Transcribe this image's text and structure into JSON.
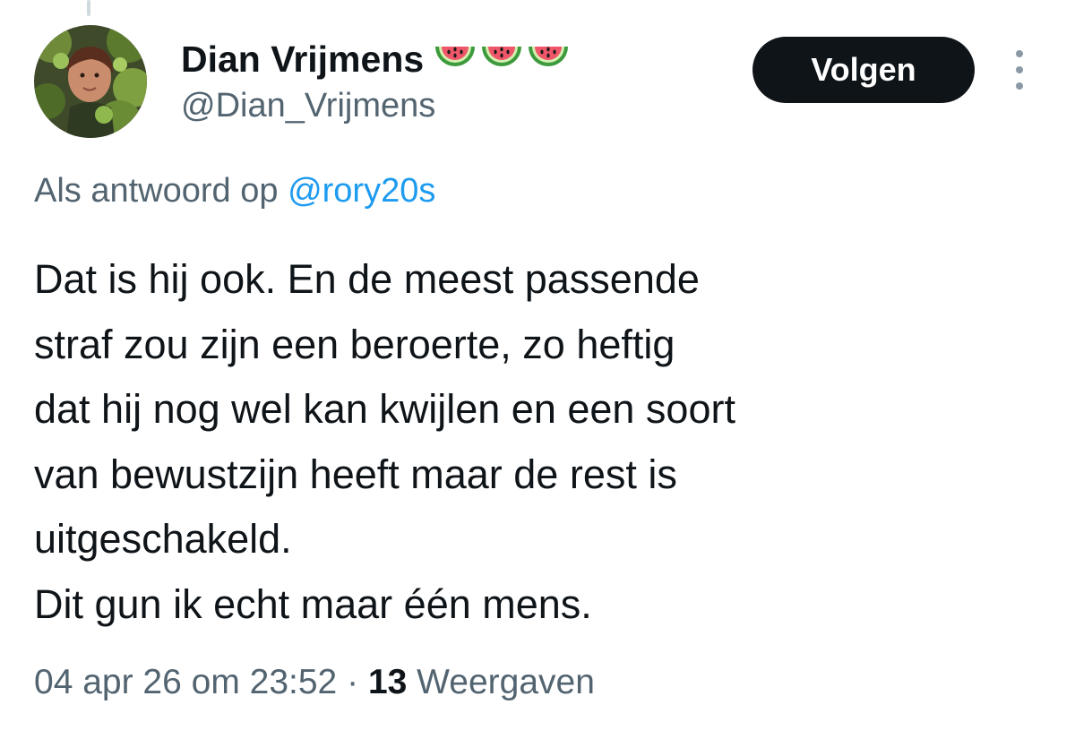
{
  "author": {
    "name": "Dian Vrijmens",
    "handle": "@Dian_Vrijmens",
    "badges": [
      "watermelon-emoji",
      "watermelon-emoji",
      "watermelon-emoji"
    ]
  },
  "follow_button": {
    "label": "Volgen"
  },
  "more_menu": {
    "icon": "more-vertical-icon"
  },
  "reply_context": {
    "prefix": "Als antwoord op",
    "mention": "@rory20s"
  },
  "tweet": {
    "lines": [
      "Dat is hij ook. En de meest passende",
      "straf zou zijn een beroerte, zo heftig",
      "dat hij nog wel kan kwijlen en een soort",
      "van bewustzijn heeft maar de rest is",
      "uitgeschakeld.",
      "Dit gun ik echt maar één mens."
    ]
  },
  "meta": {
    "timestamp": "04 apr 26 om 23:52",
    "separator": "·",
    "views_count": "13",
    "views_label": "Weergaven"
  },
  "colors": {
    "text": "#0f1419",
    "secondary": "#536471",
    "link": "#1d9bf0",
    "button_bg": "#0f1419",
    "button_text": "#ffffff"
  }
}
